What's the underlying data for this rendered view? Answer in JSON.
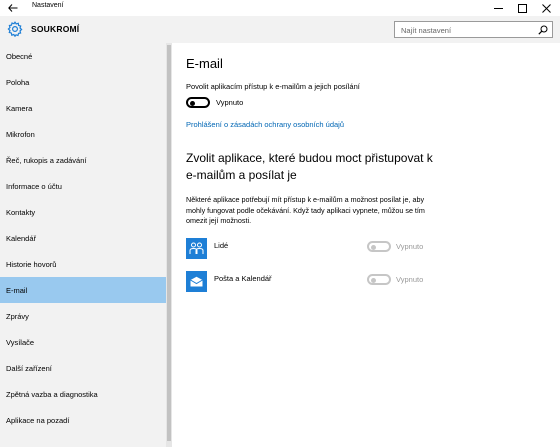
{
  "window": {
    "title": "Nastavení"
  },
  "header": {
    "section_title": "SOUKROMÍ",
    "search_placeholder": "Najít nastavení"
  },
  "sidebar": {
    "items": [
      {
        "label": "Obecné"
      },
      {
        "label": "Poloha"
      },
      {
        "label": "Kamera"
      },
      {
        "label": "Mikrofon"
      },
      {
        "label": "Řeč, rukopis a zadávání"
      },
      {
        "label": "Informace o účtu"
      },
      {
        "label": "Kontakty"
      },
      {
        "label": "Kalendář"
      },
      {
        "label": "Historie hovorů"
      },
      {
        "label": "E-mail",
        "active": true
      },
      {
        "label": "Zprávy"
      },
      {
        "label": "Vysílače"
      },
      {
        "label": "Další zařízení"
      },
      {
        "label": "Zpětná vazba a diagnostika"
      },
      {
        "label": "Aplikace na pozadí"
      }
    ]
  },
  "main": {
    "title": "E-mail",
    "allow_label": "Povolit aplikacím přístup k e-mailům a jejich posílání",
    "allow_state": "Vypnuto",
    "privacy_link": "Prohlášení o zásadách ochrany osobních údajů",
    "choose_heading": "Zvolit aplikace, které budou moct přistupovat k e-mailům a posílat je",
    "description": "Některé aplikace potřebují mít přístup k e-mailům a možnost posílat je, aby mohly fungovat podle očekávání. Když tady aplikaci vypnete, můžou se tím omezit její možnosti.",
    "apps": [
      {
        "name": "Lidé",
        "state": "Vypnuto",
        "icon": "people-icon"
      },
      {
        "name": "Pošta a Kalendář",
        "state": "Vypnuto",
        "icon": "mail-icon"
      }
    ]
  },
  "colors": {
    "accent": "#1e7fd6",
    "link": "#0066b4",
    "active_item": "#99c9ef",
    "sidebar_bg": "#f2f2f2"
  }
}
